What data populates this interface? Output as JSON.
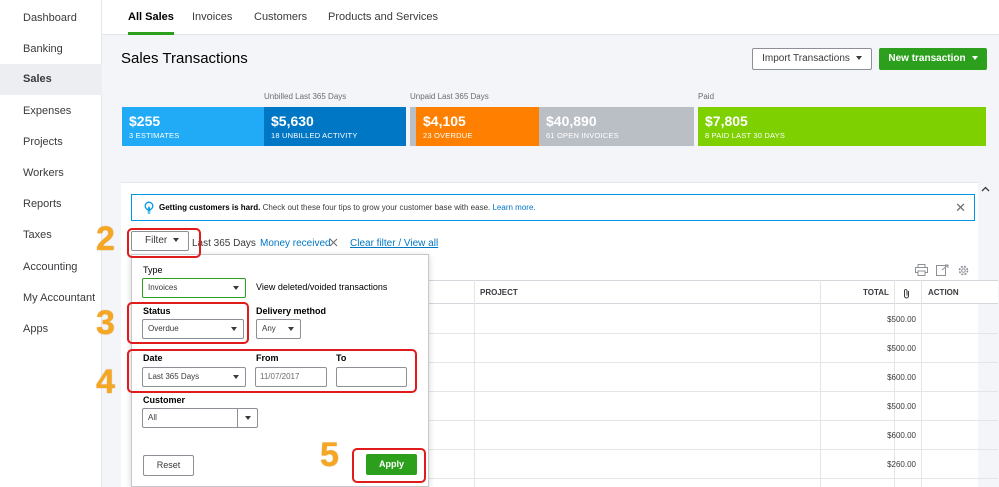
{
  "sidebar": {
    "items": [
      {
        "label": "Dashboard"
      },
      {
        "label": "Banking"
      },
      {
        "label": "Sales"
      },
      {
        "label": "Expenses"
      },
      {
        "label": "Projects"
      },
      {
        "label": "Workers"
      },
      {
        "label": "Reports"
      },
      {
        "label": "Taxes"
      },
      {
        "label": "Accounting"
      },
      {
        "label": "My Accountant"
      },
      {
        "label": "Apps"
      }
    ],
    "active": "Sales"
  },
  "tabs": [
    {
      "label": "All Sales"
    },
    {
      "label": "Invoices"
    },
    {
      "label": "Customers"
    },
    {
      "label": "Products and Services"
    }
  ],
  "page": {
    "title": "Sales Transactions",
    "import_label": "Import Transactions",
    "new_label": "New transaction"
  },
  "money_bar": {
    "labels": {
      "unbilled": "Unbilled Last 365 Days",
      "unpaid": "Unpaid Last 365 Days",
      "paid": "Paid"
    },
    "tiles": [
      {
        "amount": "$255",
        "sub": "3 ESTIMATES",
        "color": "#21abf6"
      },
      {
        "amount": "$5,630",
        "sub": "18 UNBILLED ACTIVITY",
        "color": "#0077c5"
      },
      {
        "amount": "$4,105",
        "sub": "23 OVERDUE",
        "color": "#ff8000"
      },
      {
        "amount": "$40,890",
        "sub": "61 OPEN INVOICES",
        "color": "#babec5"
      },
      {
        "amount": "$7,805",
        "sub": "8 PAID LAST 30 DAYS",
        "color": "#7fd000"
      }
    ]
  },
  "tip": {
    "bold": "Getting customers is hard.",
    "text": " Check out these four tips to grow your customer base with ease. ",
    "link": "Learn more."
  },
  "filter_bar": {
    "filter_label": "Filter",
    "date_chip": "Last 365 Days",
    "status_chip": "Money received",
    "clear_link": "Clear filter / View all"
  },
  "table": {
    "headers": {
      "project": "PROJECT",
      "total": "TOTAL",
      "action": "ACTION"
    },
    "totals": [
      "$500.00",
      "$500.00",
      "$600.00",
      "$500.00",
      "$600.00",
      "$260.00"
    ]
  },
  "filter_panel": {
    "type_label": "Type",
    "type_value": "Invoices",
    "view_deleted": "View deleted/voided transactions",
    "status_label": "Status",
    "status_value": "Overdue",
    "delivery_label": "Delivery method",
    "delivery_value": "Any",
    "date_label": "Date",
    "date_value": "Last 365 Days",
    "from_label": "From",
    "from_value": "11/07/2017",
    "to_label": "To",
    "to_value": "",
    "customer_label": "Customer",
    "customer_value": "All",
    "reset_label": "Reset",
    "apply_label": "Apply"
  },
  "annotations": {
    "steps": [
      "2",
      "3",
      "4",
      "5"
    ],
    "color": "#e01b1b",
    "number_color": "#f5a623"
  }
}
